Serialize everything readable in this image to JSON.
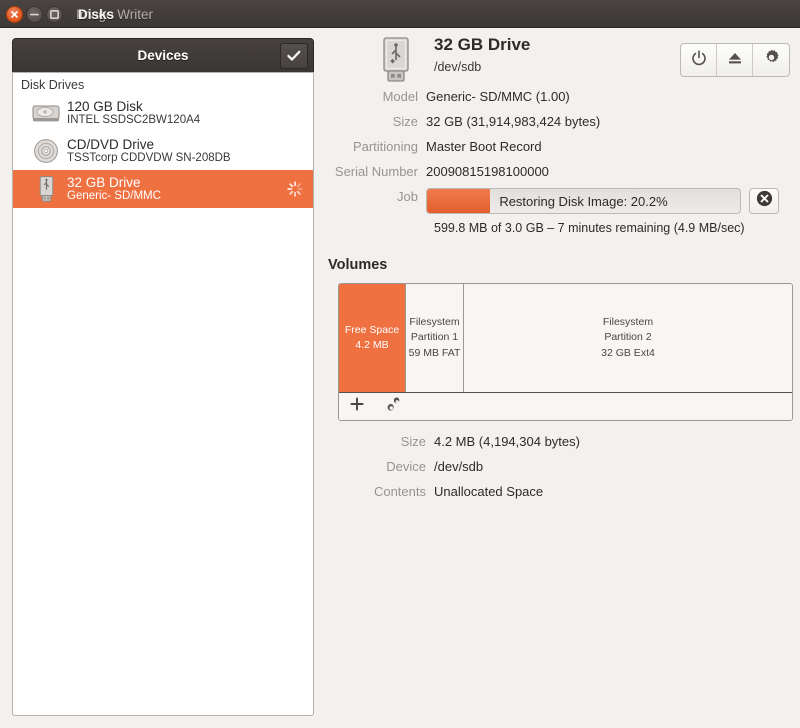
{
  "titlebar": {
    "app_title": "Disks",
    "window_subtitle": "Image Writer",
    "close_icon": "close-icon",
    "minimize_icon": "minimize-icon",
    "maximize_icon": "maximize-icon"
  },
  "sidebar": {
    "header_title": "Devices",
    "check_button_icon": "checkmark-icon",
    "group_label": "Disk Drives",
    "devices": [
      {
        "name": "120 GB Disk",
        "model": "INTEL SSDSC2BW120A4",
        "icon": "hard-disk-icon",
        "selected": false
      },
      {
        "name": "CD/DVD Drive",
        "model": "TSSTcorp CDDVDW SN-208DB",
        "icon": "optical-disc-icon",
        "selected": false
      },
      {
        "name": "32 GB Drive",
        "model": "Generic- SD/MMC",
        "icon": "usb-drive-icon",
        "selected": true
      }
    ],
    "busy_icon": "spinner-icon"
  },
  "drive": {
    "icon": "usb-drive-icon",
    "title": "32 GB Drive",
    "device_path": "/dev/sdb",
    "buttons": [
      {
        "name": "power-button",
        "icon": "power-icon"
      },
      {
        "name": "eject-button",
        "icon": "eject-icon"
      },
      {
        "name": "drive-options-button",
        "icon": "gear-icon"
      }
    ],
    "info": [
      {
        "label": "Model",
        "value": "Generic- SD/MMC (1.00)"
      },
      {
        "label": "Size",
        "value": "32 GB (31,914,983,424 bytes)"
      },
      {
        "label": "Partitioning",
        "value": "Master Boot Record"
      },
      {
        "label": "Serial Number",
        "value": "20090815198100000"
      }
    ],
    "job": {
      "label": "Job",
      "progress_text": "Restoring Disk Image: 20.2%",
      "percent": 20.2,
      "detail": "599.8 MB of 3.0 GB – 7 minutes remaining (4.9 MB/sec)",
      "cancel_icon": "cancel-circle-icon"
    }
  },
  "volumes": {
    "title": "Volumes",
    "partitions": [
      {
        "name": "free-space",
        "line1": "Free Space",
        "line2": "4.2 MB",
        "line3": "",
        "width_pct": 14.8,
        "free": true
      },
      {
        "name": "partition-1",
        "line1": "Filesystem",
        "line2": "Partition 1",
        "line3": "59 MB FAT",
        "width_pct": 12.8,
        "free": false
      },
      {
        "name": "partition-2",
        "line1": "Filesystem",
        "line2": "Partition 2",
        "line3": "32 GB Ext4",
        "width_pct": 72.4,
        "free": false
      }
    ],
    "toolbar": [
      {
        "name": "create-partition-button",
        "icon": "plus-icon"
      },
      {
        "name": "partition-options-button",
        "icon": "gears-icon"
      }
    ],
    "details": [
      {
        "label": "Size",
        "value": "4.2 MB (4,194,304 bytes)"
      },
      {
        "label": "Device",
        "value": "/dev/sdb"
      },
      {
        "label": "Contents",
        "value": "Unallocated Space"
      }
    ]
  },
  "colors": {
    "accent_orange": "#ef7142",
    "titlebar_dark": "#3c3836",
    "panel_bg": "#f2f1f0"
  }
}
